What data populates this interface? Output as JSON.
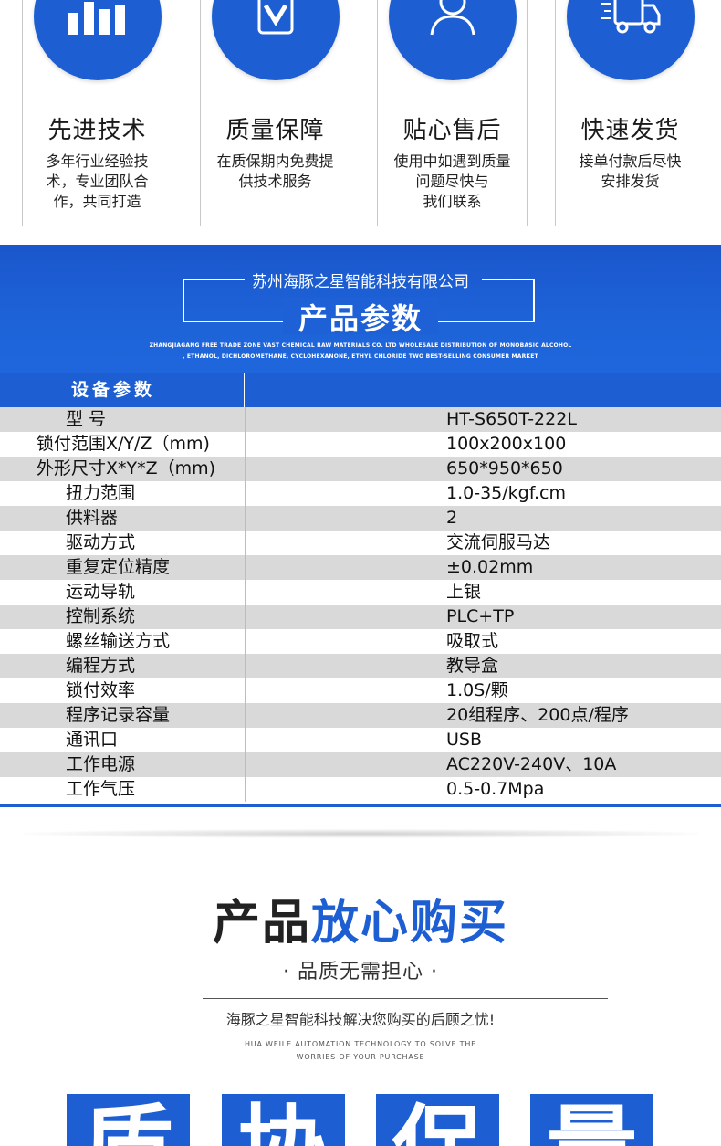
{
  "features": [
    {
      "icon": "bar-chart-icon",
      "title": "先进技术",
      "desc_lines": [
        "多年行业经验技",
        "术，专业团队合",
        "作，共同打造"
      ]
    },
    {
      "icon": "shield-check-icon",
      "title": "质量保障",
      "desc_lines": [
        "在质保期内免费提",
        "供技术服务"
      ]
    },
    {
      "icon": "users-icon",
      "title": "贴心售后",
      "desc_lines": [
        "使用中如遇到质量",
        "问题尽快与",
        "我们联系"
      ]
    },
    {
      "icon": "truck-icon",
      "title": "快速发货",
      "desc_lines": [
        "接单付款后尽快",
        "安排发货"
      ]
    }
  ],
  "banner": {
    "company": "苏州海豚之星智能科技有限公司",
    "title": "产品参数",
    "en_line1": "ZHANGJIAGANG FREE TRADE ZONE VAST CHEMICAL RAW MATERIALS CO. LTD WHOLESALE DISTRIBUTION OF MONOBASIC ALCOHOL",
    "en_line2": ", ETHANOL, DICHLOROMETHANE, CYCLOHEXANONE, ETHYL CHLORIDE TWO BEST-SELLING CONSUMER MARKET"
  },
  "params": {
    "header": "设备参数",
    "rows": [
      {
        "k": "型        号",
        "v": "HT-S650T-222L"
      },
      {
        "k": "锁付范围X/Y/Z（mm)",
        "v": "100x200x100"
      },
      {
        "k": "外形尺寸X*Y*Z（mm)",
        "v": "650*950*650"
      },
      {
        "k": "扭力范围",
        "v": "1.0-35/kgf.cm"
      },
      {
        "k": "供料器",
        "v": "2"
      },
      {
        "k": "驱动方式",
        "v": "交流伺服马达"
      },
      {
        "k": "重复定位精度",
        "v": "±0.02mm"
      },
      {
        "k": "运动导轨",
        "v": "上银"
      },
      {
        "k": "控制系统",
        "v": "PLC+TP"
      },
      {
        "k": "螺丝输送方式",
        "v": "吸取式"
      },
      {
        "k": "编程方式",
        "v": "教导盒"
      },
      {
        "k": "锁付效率",
        "v": "1.0S/颗"
      },
      {
        "k": "程序记录容量",
        "v": "20组程序、200点/程序"
      },
      {
        "k": "通讯口",
        "v": "USB"
      },
      {
        "k": "工作电源",
        "v": "AC220V-240V、10A"
      },
      {
        "k": "工作气压",
        "v": "0.5-0.7Mpa"
      }
    ]
  },
  "buy": {
    "title_dark": "产品",
    "title_blue": "放心购买",
    "subtitle": "· 品质无需担心 ·",
    "desc": "海豚之星智能科技解决您购买的后顾之忧!",
    "en_line1": "HUA WEILE AUTOMATION TECHNOLOGY TO SOLVE THE",
    "en_line2": "WORRIES OF YOUR PURCHASE"
  },
  "tiles": [
    "质",
    "协",
    "保",
    "量"
  ],
  "colors": {
    "brand_blue": "#1d5fd3",
    "row_gray": "#d9d9d9"
  }
}
